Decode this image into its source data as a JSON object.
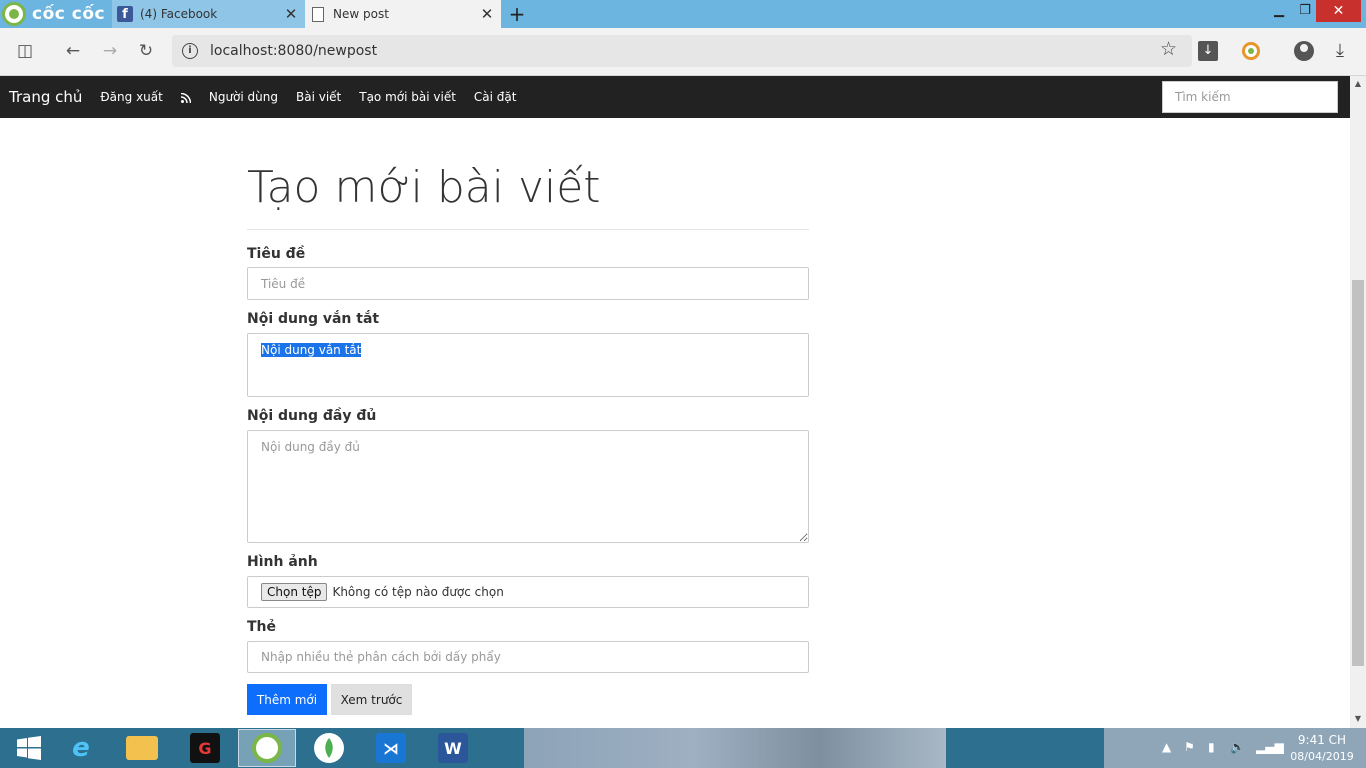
{
  "browser": {
    "brand": "cốc cốc",
    "tabs": [
      {
        "label": "(4) Facebook",
        "icon": "facebook-icon",
        "active": false
      },
      {
        "label": "New post",
        "icon": "document-icon",
        "active": true
      }
    ],
    "url": "localhost:8080/newpost"
  },
  "navbar": {
    "brand": "Trang chủ",
    "links": [
      "Đăng xuất",
      "Người dùng",
      "Bài viết",
      "Tạo mới bài viết",
      "Cài đặt"
    ],
    "search_placeholder": "Tìm kiếm"
  },
  "form": {
    "heading": "Tạo mới bài viết",
    "title_label": "Tiêu đề",
    "title_placeholder": "Tiêu đề",
    "summary_label": "Nội dung vắn tắt",
    "summary_value": "Nội dung vắn tắt",
    "content_label": "Nội dung đầy đủ",
    "content_placeholder": "Nội dung đầy đủ",
    "image_label": "Hình ảnh",
    "file_button": "Chọn tệp",
    "file_status": "Không có tệp nào được chọn",
    "tags_label": "Thẻ",
    "tags_placeholder": "Nhập nhiều thẻ phân cách bởi dấy phẩy",
    "submit_label": "Thêm mới",
    "preview_label": "Xem trước"
  },
  "taskbar": {
    "apps": [
      "windows-start",
      "internet-explorer",
      "file-explorer",
      "garena",
      "coccoc",
      "mongodb-compass",
      "vscode",
      "word"
    ],
    "time": "9:41 CH",
    "date": "08/04/2019"
  },
  "colors": {
    "titlebar": "#6cb5e0",
    "navbar": "#222222",
    "primary": "#0d6efd",
    "taskbar": "#2d6f8f"
  }
}
